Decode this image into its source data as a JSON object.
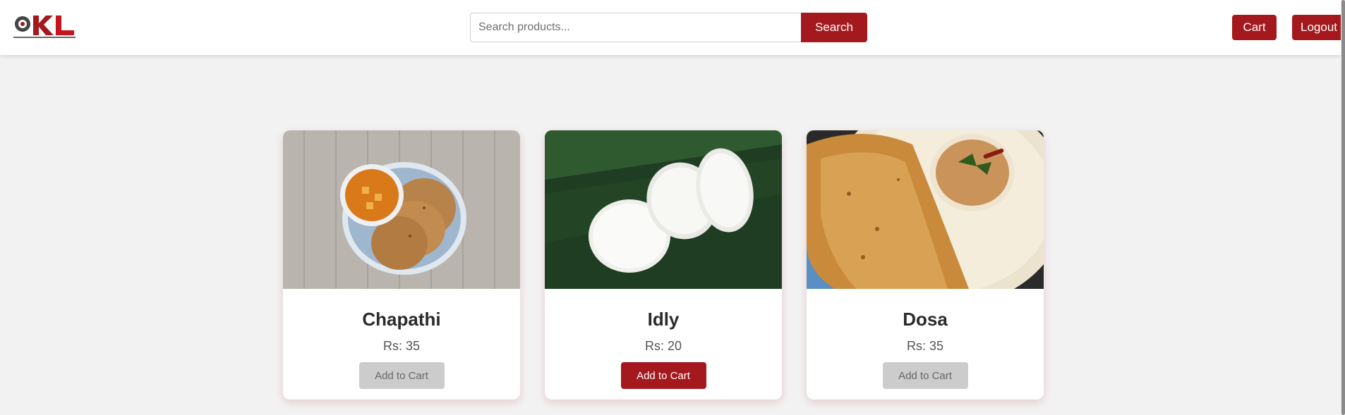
{
  "header": {
    "logo_alt": "KL University",
    "search": {
      "placeholder": "Search products...",
      "button_label": "Search"
    },
    "cart_label": "Cart",
    "logout_label": "Logout"
  },
  "colors": {
    "accent": "#a3191e",
    "disabled": "#cccccc",
    "background": "#f3f2f2"
  },
  "products": [
    {
      "name": "Chapathi",
      "price": "Rs: 35",
      "button_label": "Add to Cart",
      "button_state": "disabled"
    },
    {
      "name": "Idly",
      "price": "Rs: 20",
      "button_label": "Add to Cart",
      "button_state": "active"
    },
    {
      "name": "Dosa",
      "price": "Rs: 35",
      "button_label": "Add to Cart",
      "button_state": "disabled"
    }
  ]
}
